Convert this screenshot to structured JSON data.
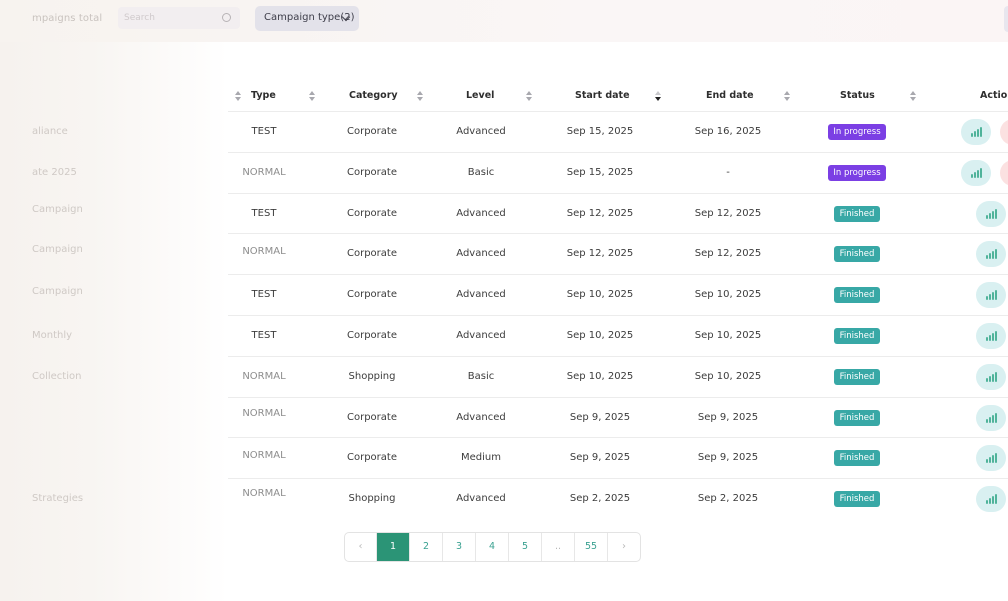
{
  "topbar": {
    "campaigns_total_label": "mpaigns total",
    "search_placeholder": "Search",
    "type_filter_label": "Campaign type(2)"
  },
  "left_labels": [
    "aliance",
    "ate 2025",
    "Campaign",
    "Campaign",
    "Campaign",
    "Monthly",
    "Collection",
    "",
    "",
    "Strategies"
  ],
  "table": {
    "columns": [
      "Type",
      "Category",
      "Level",
      "Start date",
      "End date",
      "Status",
      "Action"
    ],
    "rows": [
      {
        "type": "TEST",
        "category": "Corporate",
        "level": "Advanced",
        "start": "Sep 15, 2025",
        "end": "Sep 16, 2025",
        "status": "In progress"
      },
      {
        "type": "NORMAL",
        "category": "Corporate",
        "level": "Basic",
        "start": "Sep 15, 2025",
        "end": "-",
        "status": "In progress"
      },
      {
        "type": "TEST",
        "category": "Corporate",
        "level": "Advanced",
        "start": "Sep 12, 2025",
        "end": "Sep 12, 2025",
        "status": "Finished"
      },
      {
        "type": "NORMAL",
        "category": "Corporate",
        "level": "Advanced",
        "start": "Sep 12, 2025",
        "end": "Sep 12, 2025",
        "status": "Finished"
      },
      {
        "type": "TEST",
        "category": "Corporate",
        "level": "Advanced",
        "start": "Sep 10, 2025",
        "end": "Sep 10, 2025",
        "status": "Finished"
      },
      {
        "type": "TEST",
        "category": "Corporate",
        "level": "Advanced",
        "start": "Sep 10, 2025",
        "end": "Sep 10, 2025",
        "status": "Finished"
      },
      {
        "type": "NORMAL",
        "category": "Shopping",
        "level": "Basic",
        "start": "Sep 10, 2025",
        "end": "Sep 10, 2025",
        "status": "Finished"
      },
      {
        "type": "NORMAL",
        "category": "Corporate",
        "level": "Advanced",
        "start": "Sep 9, 2025",
        "end": "Sep 9, 2025",
        "status": "Finished"
      },
      {
        "type": "NORMAL",
        "category": "Corporate",
        "level": "Medium",
        "start": "Sep 9, 2025",
        "end": "Sep 9, 2025",
        "status": "Finished"
      },
      {
        "type": "NORMAL",
        "category": "Shopping",
        "level": "Advanced",
        "start": "Sep 2, 2025",
        "end": "Sep 2, 2025",
        "status": "Finished"
      }
    ]
  },
  "pagination": {
    "prev": "‹",
    "pages": [
      "1",
      "2",
      "3",
      "4",
      "5",
      "..",
      "55"
    ],
    "next": "›",
    "active": "1"
  },
  "colors": {
    "in_progress": "#7b3fe4",
    "finished": "#38a8a6",
    "pagination_active": "#2b9476",
    "action_button": "#d9f0f1"
  },
  "icons": {
    "search": "search-icon",
    "filter_chevron": "chevron-down-icon",
    "sort": "sort-icon",
    "action": "stats-icon"
  }
}
